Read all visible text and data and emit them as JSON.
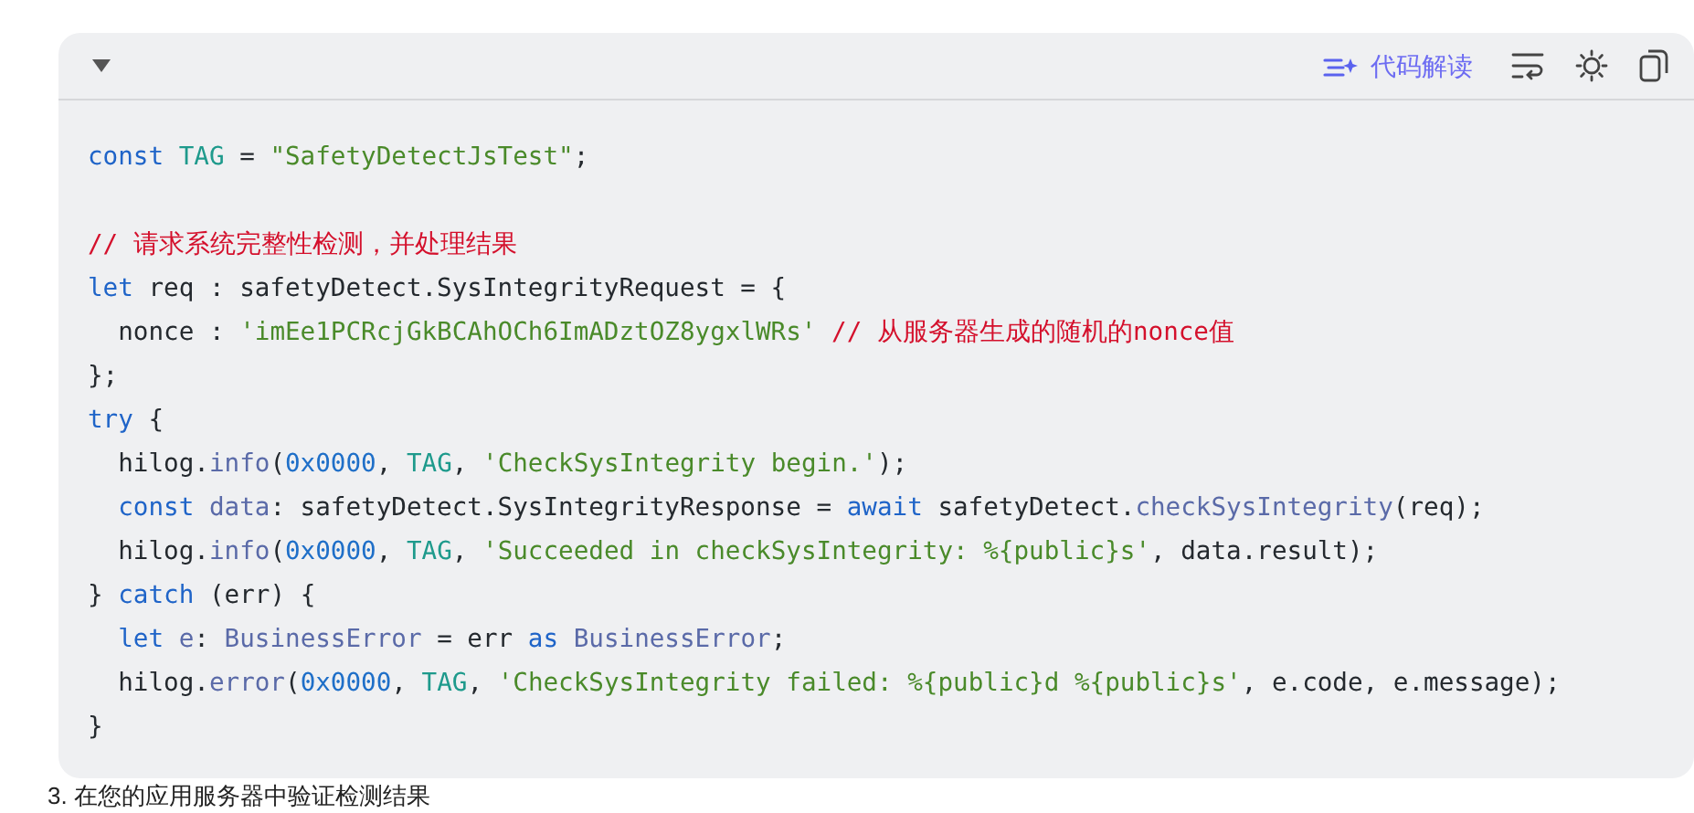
{
  "code_block": {
    "collapsed": false,
    "toolbar": {
      "explain_label": "代码解读"
    },
    "lines": [
      {
        "kind": "code",
        "tokens": [
          {
            "t": "const ",
            "kind": "keyword"
          },
          {
            "t": "TAG",
            "kind": "constant"
          },
          {
            "t": " = ",
            "kind": "plain"
          },
          {
            "t": "\"SafetyDetectJsTest\"",
            "kind": "string"
          },
          {
            "t": ";",
            "kind": "plain"
          }
        ]
      },
      {
        "kind": "blank"
      },
      {
        "kind": "code",
        "tokens": [
          {
            "t": "// 请求系统完整性检测，并处理结果",
            "kind": "comment"
          }
        ]
      },
      {
        "kind": "code",
        "tokens": [
          {
            "t": "let",
            "kind": "keyword"
          },
          {
            "t": " req : safetyDetect.SysIntegrityRequest = {",
            "kind": "plain"
          }
        ]
      },
      {
        "kind": "code",
        "tokens": [
          {
            "t": "  nonce : ",
            "kind": "plain"
          },
          {
            "t": "'imEe1PCRcjGkBCAhOCh6ImADztOZ8ygxlWRs'",
            "kind": "string"
          },
          {
            "t": " // 从服务器生成的随机的nonce值",
            "kind": "comment"
          }
        ]
      },
      {
        "kind": "code",
        "tokens": [
          {
            "t": "};",
            "kind": "plain"
          }
        ]
      },
      {
        "kind": "code",
        "tokens": [
          {
            "t": "try",
            "kind": "keyword"
          },
          {
            "t": " {",
            "kind": "plain"
          }
        ]
      },
      {
        "kind": "code",
        "tokens": [
          {
            "t": "  hilog.",
            "kind": "plain"
          },
          {
            "t": "info",
            "kind": "function"
          },
          {
            "t": "(",
            "kind": "plain"
          },
          {
            "t": "0x0000",
            "kind": "number"
          },
          {
            "t": ", ",
            "kind": "plain"
          },
          {
            "t": "TAG",
            "kind": "constant"
          },
          {
            "t": ", ",
            "kind": "plain"
          },
          {
            "t": "'CheckSysIntegrity begin.'",
            "kind": "string"
          },
          {
            "t": ");",
            "kind": "plain"
          }
        ]
      },
      {
        "kind": "code",
        "tokens": [
          {
            "t": "  const ",
            "kind": "keyword"
          },
          {
            "t": "data",
            "kind": "function"
          },
          {
            "t": ": safetyDetect.SysIntegrityResponse = ",
            "kind": "plain"
          },
          {
            "t": "await",
            "kind": "keyword"
          },
          {
            "t": " safetyDetect.",
            "kind": "plain"
          },
          {
            "t": "checkSysIntegrity",
            "kind": "function"
          },
          {
            "t": "(req);",
            "kind": "plain"
          }
        ]
      },
      {
        "kind": "code",
        "tokens": [
          {
            "t": "  hilog.",
            "kind": "plain"
          },
          {
            "t": "info",
            "kind": "function"
          },
          {
            "t": "(",
            "kind": "plain"
          },
          {
            "t": "0x0000",
            "kind": "number"
          },
          {
            "t": ", ",
            "kind": "plain"
          },
          {
            "t": "TAG",
            "kind": "constant"
          },
          {
            "t": ", ",
            "kind": "plain"
          },
          {
            "t": "'Succeeded in checkSysIntegrity: %{public}s'",
            "kind": "string"
          },
          {
            "t": ", data.result);",
            "kind": "plain"
          }
        ]
      },
      {
        "kind": "code",
        "tokens": [
          {
            "t": "} ",
            "kind": "plain"
          },
          {
            "t": "catch",
            "kind": "keyword"
          },
          {
            "t": " (err) {",
            "kind": "plain"
          }
        ]
      },
      {
        "kind": "code",
        "tokens": [
          {
            "t": "  let ",
            "kind": "keyword"
          },
          {
            "t": "e",
            "kind": "function"
          },
          {
            "t": ": ",
            "kind": "plain"
          },
          {
            "t": "BusinessError",
            "kind": "function"
          },
          {
            "t": " = err ",
            "kind": "plain"
          },
          {
            "t": "as ",
            "kind": "keyword"
          },
          {
            "t": "BusinessError",
            "kind": "function"
          },
          {
            "t": ";",
            "kind": "plain"
          }
        ]
      },
      {
        "kind": "code",
        "tokens": [
          {
            "t": "  hilog.",
            "kind": "plain"
          },
          {
            "t": "error",
            "kind": "function"
          },
          {
            "t": "(",
            "kind": "plain"
          },
          {
            "t": "0x0000",
            "kind": "number"
          },
          {
            "t": ", ",
            "kind": "plain"
          },
          {
            "t": "TAG",
            "kind": "constant"
          },
          {
            "t": ", ",
            "kind": "plain"
          },
          {
            "t": "'CheckSysIntegrity failed: %{public}d %{public}s'",
            "kind": "string"
          },
          {
            "t": ", e.code, e.message);",
            "kind": "plain"
          }
        ]
      },
      {
        "kind": "code",
        "tokens": [
          {
            "t": "}",
            "kind": "plain"
          }
        ]
      }
    ]
  },
  "next_step": "3. 在您的应用服务器中验证检测结果"
}
